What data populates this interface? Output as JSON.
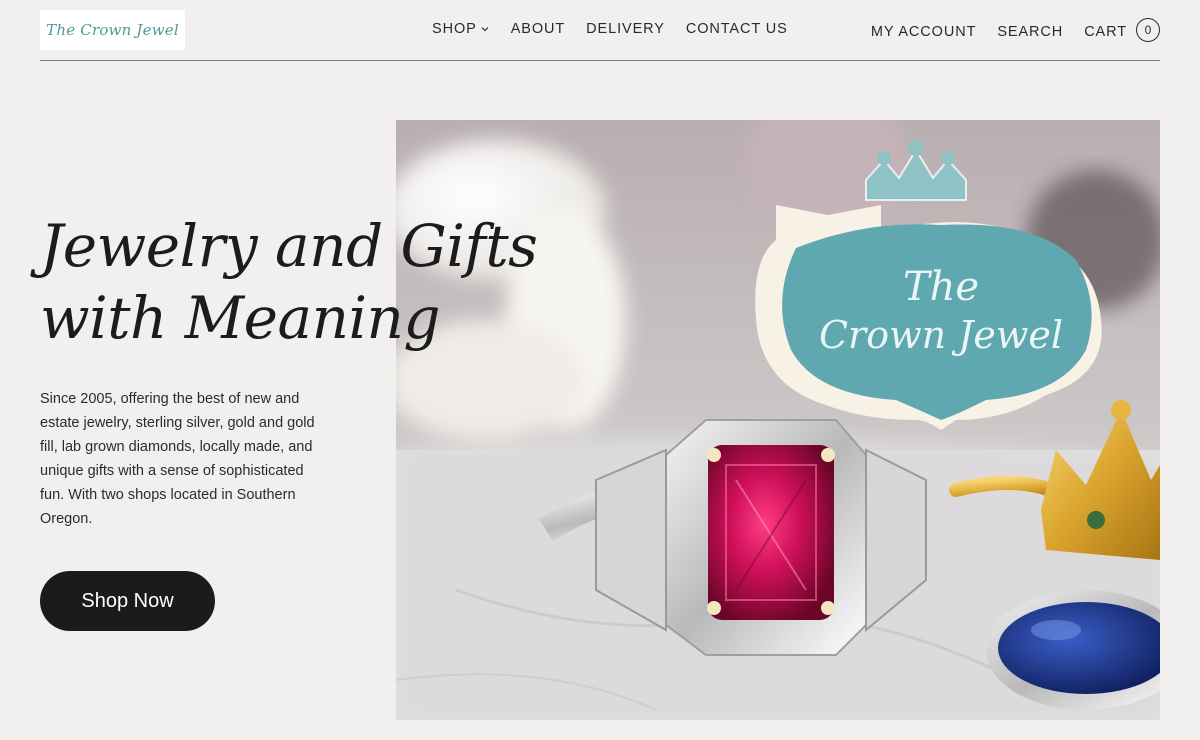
{
  "header": {
    "logo_text": "The Crown Jewel",
    "nav": [
      {
        "label": "SHOP",
        "has_dropdown": true
      },
      {
        "label": "ABOUT"
      },
      {
        "label": "DELIVERY"
      },
      {
        "label": "CONTACT US"
      }
    ],
    "utility": {
      "account": "MY ACCOUNT",
      "search": "SEARCH",
      "cart": "CART",
      "cart_count": "0"
    }
  },
  "hero": {
    "title_line1": "Jewelry and Gifts",
    "title_line2": "with Meaning",
    "description": "Since 2005, offering the best of new and estate jewelry, sterling silver, gold and gold fill, lab grown diamonds, locally made, and unique gifts with a sense of sophisticated fun. With two shops located in Southern Oregon.",
    "cta_label": "Shop Now",
    "image_sign_text_1": "The",
    "image_sign_text_2": "Crown Jewel"
  },
  "colors": {
    "page_bg": "#f2f0ee",
    "button_bg": "#1b1b1b",
    "brand_teal": "#4f9a96",
    "ruby": "#c0124a"
  },
  "icons": {
    "shop_dropdown": "chevron-down-icon",
    "cart": "cart-count-badge"
  }
}
